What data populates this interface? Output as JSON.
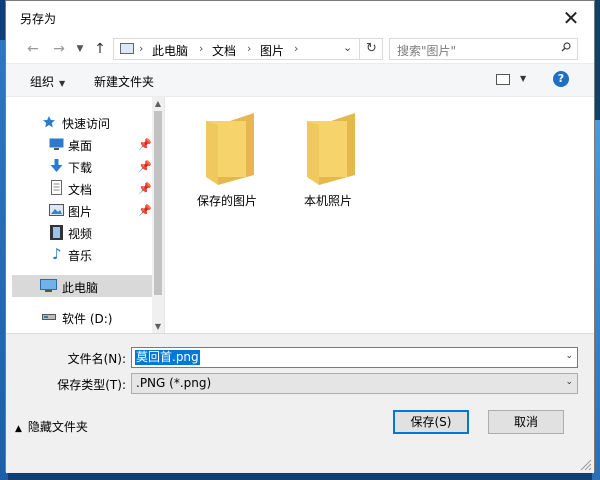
{
  "dialog": {
    "title": "另存为"
  },
  "nav": {
    "breadcrumbs": [
      "此电脑",
      "文档",
      "图片"
    ],
    "search_placeholder": "搜索\"图片\""
  },
  "toolbar": {
    "organize": "组织",
    "new_folder": "新建文件夹"
  },
  "sidebar": {
    "items": [
      {
        "label": "快速访问",
        "icon": "star-icon",
        "pinned": false
      },
      {
        "label": "桌面",
        "icon": "desktop-icon",
        "pinned": true
      },
      {
        "label": "下载",
        "icon": "download-icon",
        "pinned": true
      },
      {
        "label": "文档",
        "icon": "document-icon",
        "pinned": true
      },
      {
        "label": "图片",
        "icon": "pictures-icon",
        "pinned": true
      },
      {
        "label": "视频",
        "icon": "video-icon",
        "pinned": false
      },
      {
        "label": "音乐",
        "icon": "music-icon",
        "pinned": false
      },
      {
        "label": "此电脑",
        "icon": "this-pc-icon",
        "pinned": false,
        "selected": true
      },
      {
        "label": "软件 (D:)",
        "icon": "drive-icon",
        "pinned": false
      }
    ]
  },
  "files": [
    {
      "name": "保存的图片",
      "type": "folder"
    },
    {
      "name": "本机照片",
      "type": "folder"
    }
  ],
  "form": {
    "filename_label": "文件名(N):",
    "filename_value": "莫回首.png",
    "filetype_label": "保存类型(T):",
    "filetype_value": ".PNG (*.png)"
  },
  "footer": {
    "hide_folders": "隐藏文件夹",
    "save": "保存(S)",
    "cancel": "取消"
  },
  "colors": {
    "accent": "#0078d7",
    "folder": "#f6d36b",
    "help": "#1f6fc5"
  }
}
